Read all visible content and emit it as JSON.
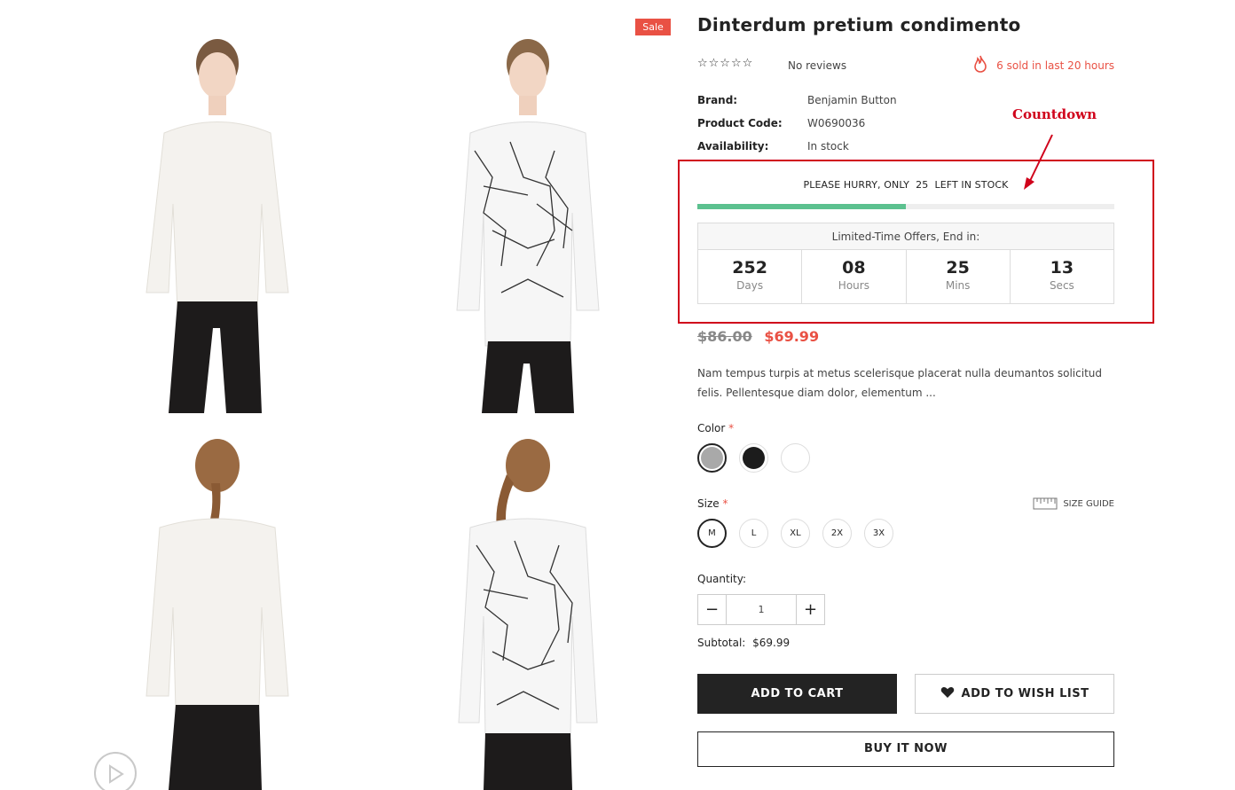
{
  "gallery": {
    "sale_badge": "Sale",
    "images": [
      "front-white-top",
      "front-patterned-top",
      "back-white-top",
      "back-patterned-top"
    ],
    "video_icon": "play-circle-icon"
  },
  "product": {
    "title": "Dinterdum pretium condimento",
    "stars": "☆☆☆☆☆",
    "reviews": "No reviews",
    "sold_text": "6 sold in last 20 hours",
    "meta": {
      "brand_label": "Brand:",
      "brand_value": "Benjamin Button",
      "code_label": "Product Code:",
      "code_value": "W0690036",
      "availability_label": "Availability:",
      "availability_value": "In stock"
    },
    "annotation": "Countdown",
    "hurry_text": "PLEASE HURRY, ONLY  25  LEFT IN STOCK",
    "stock_fill_fraction": 0.5,
    "timer": {
      "heading": "Limited-Time Offers, End in:",
      "cells": [
        {
          "value": "252",
          "unit": "Days"
        },
        {
          "value": "08",
          "unit": "Hours"
        },
        {
          "value": "25",
          "unit": "Mins"
        },
        {
          "value": "13",
          "unit": "Secs"
        }
      ]
    },
    "old_price": "$86.00",
    "new_price": "$69.99",
    "description": "Nam tempus turpis at metus scelerisque placerat nulla deumantos solicitud felis. Pellentesque diam dolor, elementum ...",
    "color_label": "Color",
    "required_mark": "*",
    "colors": [
      "#a9a9a9",
      "#1c1c1c",
      "#ffffff"
    ],
    "size_label": "Size",
    "size_guide": "SIZE GUIDE",
    "sizes": [
      "M",
      "L",
      "XL",
      "2X",
      "3X"
    ],
    "quantity_label": "Quantity:",
    "quantity_value": "1",
    "subtotal_label": "Subtotal:",
    "subtotal_value": "$69.99",
    "add_to_cart": "ADD TO CART",
    "add_to_wishlist": "ADD TO WISH LIST",
    "buy_now": "BUY IT NOW"
  },
  "colors": {
    "accent_red": "#e95144",
    "annotation_red": "#d0021b",
    "stock_green": "#5cc18f",
    "dark": "#232323"
  }
}
